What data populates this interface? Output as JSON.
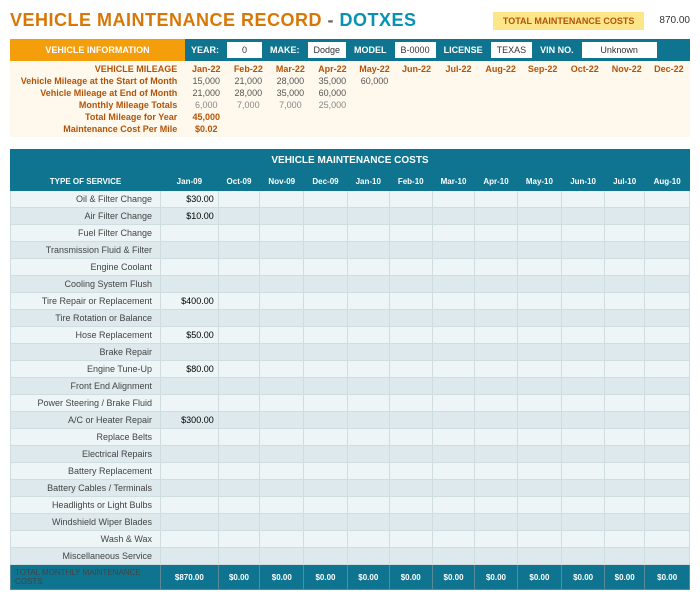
{
  "header": {
    "title_part1": "VEHICLE MAINTENANCE RECORD",
    "title_sep": " - ",
    "title_part2": "DOTXES",
    "total_label": "TOTAL MAINTENANCE COSTS",
    "total_value": "870.00"
  },
  "info": {
    "section_label": "VEHICLE INFORMATION",
    "fields": [
      {
        "label": "YEAR:",
        "value": "0"
      },
      {
        "label": "MAKE:",
        "value": "Dodge"
      },
      {
        "label": "MODEL",
        "value": "B-0000"
      },
      {
        "label": "LICENSE",
        "value": "TEXAS"
      },
      {
        "label": "VIN NO.",
        "value": "Unknown",
        "wide": true
      }
    ]
  },
  "mileage": {
    "months": [
      "Jan-22",
      "Feb-22",
      "Mar-22",
      "Apr-22",
      "May-22",
      "Jun-22",
      "Jul-22",
      "Aug-22",
      "Sep-22",
      "Oct-22",
      "Nov-22",
      "Dec-22"
    ],
    "rows": [
      {
        "label": "VEHICLE MILEAGE",
        "values": [],
        "head": true
      },
      {
        "label": "Vehicle Mileage at the Start of Month",
        "values": [
          "15,000",
          "21,000",
          "28,000",
          "35,000",
          "60,000"
        ]
      },
      {
        "label": "Vehicle Mileage at End of Month",
        "values": [
          "21,000",
          "28,000",
          "35,000",
          "60,000"
        ]
      },
      {
        "label": "Monthly Mileage Totals",
        "values": [
          "6,000",
          "7,000",
          "7,000",
          "25,000"
        ],
        "muted": true
      },
      {
        "label": "Total Mileage for Year",
        "values": [
          "45,000"
        ],
        "bold": true
      },
      {
        "label": "Maintenance Cost Per Mile",
        "values": [
          "$0.02"
        ],
        "bold": true
      }
    ]
  },
  "costs": {
    "title": "VEHICLE MAINTENANCE COSTS",
    "type_header": "TYPE OF SERVICE",
    "months": [
      "Jan-09",
      "Oct-09",
      "Nov-09",
      "Dec-09",
      "Jan-10",
      "Feb-10",
      "Mar-10",
      "Apr-10",
      "May-10",
      "Jun-10",
      "Jul-10",
      "Aug-10"
    ],
    "services": [
      {
        "name": "Oil & Filter Change",
        "vals": [
          "$30.00"
        ]
      },
      {
        "name": "Air Filter Change",
        "vals": [
          "$10.00"
        ]
      },
      {
        "name": "Fuel Filter Change",
        "vals": []
      },
      {
        "name": "Transmission Fluid & Filter",
        "vals": []
      },
      {
        "name": "Engine Coolant",
        "vals": []
      },
      {
        "name": "Cooling System Flush",
        "vals": []
      },
      {
        "name": "Tire Repair or Replacement",
        "vals": [
          "$400.00"
        ]
      },
      {
        "name": "Tire Rotation or Balance",
        "vals": []
      },
      {
        "name": "Hose Replacement",
        "vals": [
          "$50.00"
        ]
      },
      {
        "name": "Brake Repair",
        "vals": []
      },
      {
        "name": "Engine Tune-Up",
        "vals": [
          "$80.00"
        ]
      },
      {
        "name": "Front End Alignment",
        "vals": []
      },
      {
        "name": "Power Steering / Brake Fluid",
        "vals": []
      },
      {
        "name": "A/C or Heater Repair",
        "vals": [
          "$300.00"
        ]
      },
      {
        "name": "Replace Belts",
        "vals": []
      },
      {
        "name": "Electrical Repairs",
        "vals": []
      },
      {
        "name": "Battery Replacement",
        "vals": []
      },
      {
        "name": "Battery Cables / Terminals",
        "vals": []
      },
      {
        "name": "Headlights or Light Bulbs",
        "vals": []
      },
      {
        "name": "Windshield Wiper Blades",
        "vals": []
      },
      {
        "name": "Wash & Wax",
        "vals": []
      },
      {
        "name": "Miscellaneous Service",
        "vals": []
      }
    ],
    "footer_label": "TOTAL MONTHLY MAINTENANCE COSTS",
    "footer_vals": [
      "$870.00",
      "$0.00",
      "$0.00",
      "$0.00",
      "$0.00",
      "$0.00",
      "$0.00",
      "$0.00",
      "$0.00",
      "$0.00",
      "$0.00",
      "$0.00"
    ]
  },
  "chart_data": {
    "type": "table",
    "title": "Vehicle Maintenance Costs by Month",
    "categories": [
      "Jan-09",
      "Oct-09",
      "Nov-09",
      "Dec-09",
      "Jan-10",
      "Feb-10",
      "Mar-10",
      "Apr-10",
      "May-10",
      "Jun-10",
      "Jul-10",
      "Aug-10"
    ],
    "series": [
      {
        "name": "Oil & Filter Change",
        "values": [
          30,
          0,
          0,
          0,
          0,
          0,
          0,
          0,
          0,
          0,
          0,
          0
        ]
      },
      {
        "name": "Air Filter Change",
        "values": [
          10,
          0,
          0,
          0,
          0,
          0,
          0,
          0,
          0,
          0,
          0,
          0
        ]
      },
      {
        "name": "Tire Repair or Replacement",
        "values": [
          400,
          0,
          0,
          0,
          0,
          0,
          0,
          0,
          0,
          0,
          0,
          0
        ]
      },
      {
        "name": "Hose Replacement",
        "values": [
          50,
          0,
          0,
          0,
          0,
          0,
          0,
          0,
          0,
          0,
          0,
          0
        ]
      },
      {
        "name": "Engine Tune-Up",
        "values": [
          80,
          0,
          0,
          0,
          0,
          0,
          0,
          0,
          0,
          0,
          0,
          0
        ]
      },
      {
        "name": "A/C or Heater Repair",
        "values": [
          300,
          0,
          0,
          0,
          0,
          0,
          0,
          0,
          0,
          0,
          0,
          0
        ]
      }
    ],
    "totals": [
      870,
      0,
      0,
      0,
      0,
      0,
      0,
      0,
      0,
      0,
      0,
      0
    ]
  }
}
